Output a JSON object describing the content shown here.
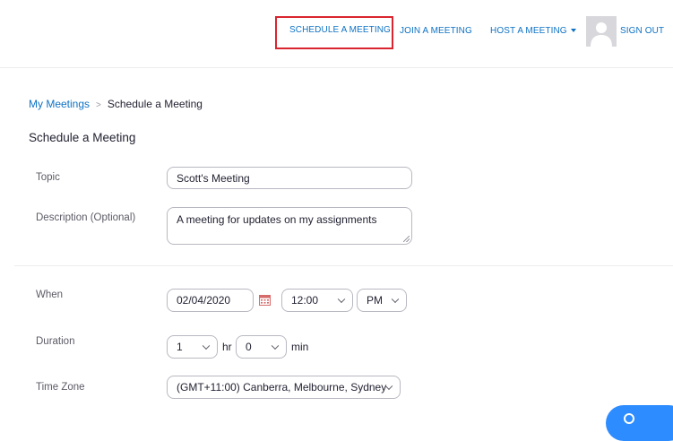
{
  "header": {
    "nav": {
      "schedule": "SCHEDULE A MEETING",
      "join": "JOIN A MEETING",
      "host": "HOST A MEETING",
      "signout": "SIGN OUT"
    }
  },
  "breadcrumb": {
    "parent": "My Meetings",
    "separator": ">",
    "current": "Schedule a Meeting"
  },
  "page": {
    "title": "Schedule a Meeting"
  },
  "form": {
    "topic": {
      "label": "Topic",
      "value": "Scott's Meeting"
    },
    "description": {
      "label": "Description (Optional)",
      "value": "A meeting for updates on my assignments"
    },
    "when": {
      "label": "When",
      "date": "02/04/2020",
      "time": "12:00",
      "ampm": "PM"
    },
    "duration": {
      "label": "Duration",
      "hours": "1",
      "hours_unit": "hr",
      "minutes": "0",
      "minutes_unit": "min"
    },
    "timezone": {
      "label": "Time Zone",
      "value": "(GMT+11:00) Canberra, Melbourne, Sydney"
    }
  },
  "colors": {
    "link": "#0e72c4",
    "highlight": "#d9252f",
    "help": "#2d8cff"
  },
  "icons": [
    "chevron-down-icon",
    "calendar-icon",
    "avatar-icon",
    "help-icon"
  ]
}
